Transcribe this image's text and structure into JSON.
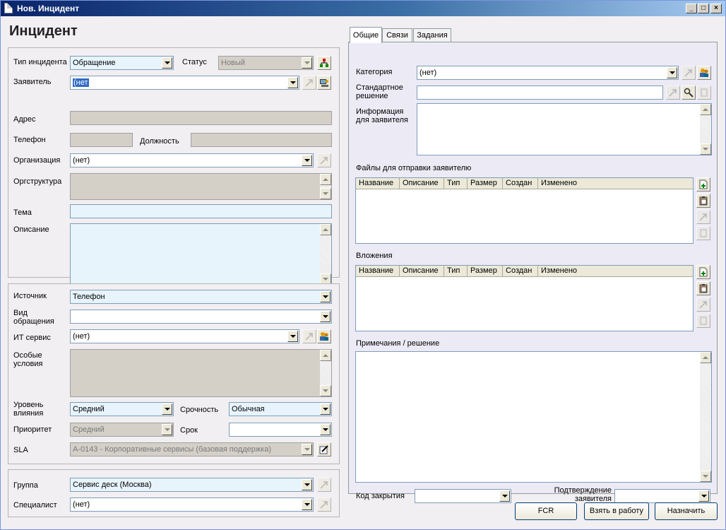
{
  "window": {
    "title": "Нов. Инцидент",
    "minimize": "_",
    "maximize": "□",
    "close": "×"
  },
  "page": {
    "heading": "Инцидент"
  },
  "main": {
    "incident_type": {
      "label": "Тип инцидента",
      "value": "Обращение"
    },
    "status": {
      "label": "Статус",
      "value": "Новый"
    },
    "requester": {
      "label": "Заявитель",
      "value": "(нет"
    },
    "address": {
      "label": "Адрес",
      "value": ""
    },
    "phone": {
      "label": "Телефон",
      "value": ""
    },
    "position": {
      "label": "Должность",
      "value": ""
    },
    "organization": {
      "label": "Организация",
      "value": "(нет)"
    },
    "org_structure": {
      "label": "Оргструктура",
      "value": ""
    },
    "subject": {
      "label": "Тема",
      "value": ""
    },
    "description": {
      "label": "Описание",
      "value": ""
    }
  },
  "details": {
    "source": {
      "label": "Источник",
      "value": "Телефон"
    },
    "request_kind": {
      "label": "Вид обращения",
      "value": ""
    },
    "it_service": {
      "label": "ИТ сервис",
      "value": "(нет)"
    },
    "special_conditions": {
      "label": "Особые условия",
      "value": ""
    },
    "impact": {
      "label": "Уровень влияния",
      "value": "Средний"
    },
    "urgency": {
      "label": "Срочность",
      "value": "Обычная"
    },
    "priority": {
      "label": "Приоритет",
      "value": "Средний"
    },
    "deadline": {
      "label": "Срок",
      "value": ""
    },
    "sla": {
      "label": "SLA",
      "value": "A-0143 - Корпоративные сервисы (базовая поддержка)"
    }
  },
  "assignment": {
    "group": {
      "label": "Группа",
      "value": "Сервис деск (Москва)"
    },
    "specialist": {
      "label": "Специалист",
      "value": "(нет)"
    }
  },
  "tabs": [
    {
      "label": "Общие",
      "active": true
    },
    {
      "label": "Связи",
      "active": false
    },
    {
      "label": "Задания",
      "active": false
    }
  ],
  "general": {
    "category": {
      "label": "Категория",
      "value": "(нет)"
    },
    "standard_solution": {
      "label": "Стандартное решение",
      "value": ""
    },
    "requester_info": {
      "label": "Информация для заявителя",
      "value": ""
    },
    "files_label": "Файлы для отправки заявителю",
    "attachments_label": "Вложения",
    "notes_label": "Примечания / решение",
    "closure_code": {
      "label": "Код закрытия",
      "value": ""
    },
    "requester_confirmation": {
      "label": "Подтверждение заявителя",
      "value": ""
    },
    "grid_columns": [
      "Название",
      "Описание",
      "Тип",
      "Размер",
      "Создан",
      "Изменено"
    ]
  },
  "buttons": {
    "fcr": "FCR",
    "take": "Взять в работу",
    "assign": "Назначить"
  },
  "colors": {
    "field_highlight": "#e7f4fc",
    "title_bar": "#0a246a",
    "selection": "#316ac5"
  }
}
